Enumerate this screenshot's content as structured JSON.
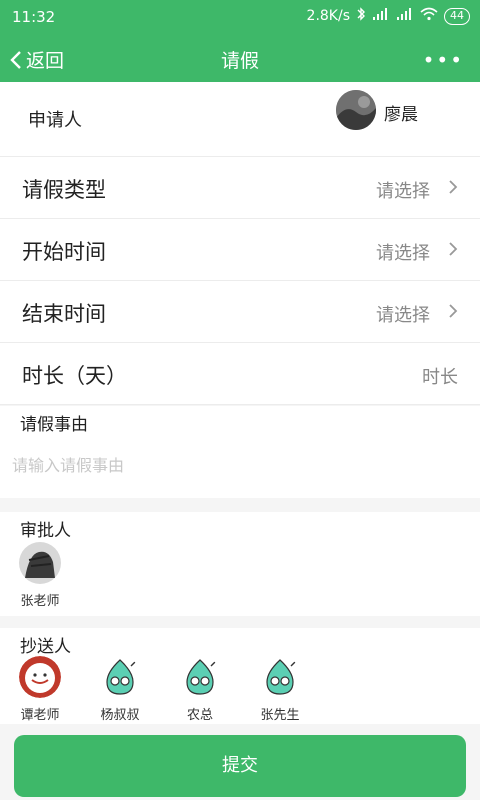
{
  "status_bar": {
    "time": "11:32",
    "net_speed": "2.8K/s",
    "battery": "44"
  },
  "nav": {
    "back_label": "返回",
    "title": "请假",
    "more": "•••"
  },
  "applicant": {
    "label": "申请人",
    "name": "廖晨"
  },
  "fields": [
    {
      "label": "请假类型",
      "value": "请选择",
      "chevron": true
    },
    {
      "label": "开始时间",
      "value": "请选择",
      "chevron": true
    },
    {
      "label": "结束时间",
      "value": "请选择",
      "chevron": true
    },
    {
      "label": "时长（天）",
      "value": "时长",
      "chevron": false
    }
  ],
  "reason": {
    "label": "请假事由",
    "placeholder": "请输入请假事由"
  },
  "approver": {
    "label": "审批人",
    "people": [
      {
        "name": "张老师"
      }
    ]
  },
  "cc": {
    "label": "抄送人",
    "people": [
      {
        "name": "谭老师"
      },
      {
        "name": "杨叔叔"
      },
      {
        "name": "农总"
      },
      {
        "name": "张先生"
      }
    ]
  },
  "submit_label": "提交",
  "colors": {
    "brand": "#3eb869",
    "placeholder": "#c8c8c8",
    "divider": "#ececec"
  }
}
